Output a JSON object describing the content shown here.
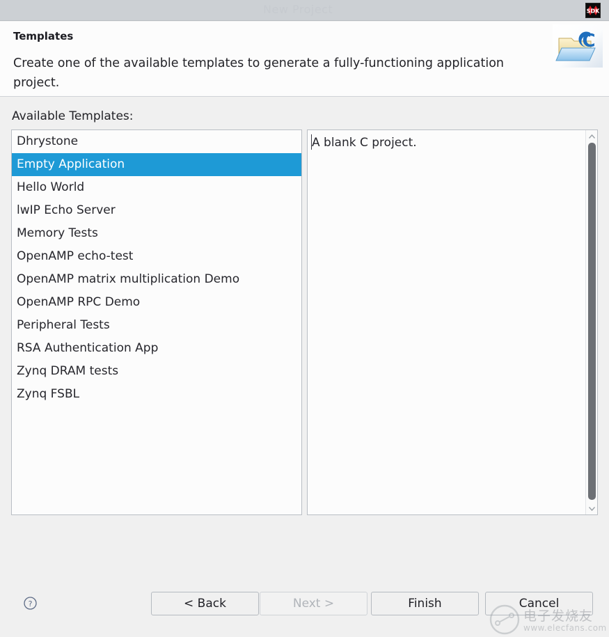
{
  "window": {
    "ghost_title": "New Project",
    "app_icon_label": "SDK"
  },
  "header": {
    "title": "Templates",
    "description": "Create one of the available templates to generate a fully-functioning application project.",
    "icon_name": "c-project-folder-icon"
  },
  "body": {
    "section_label": "Available Templates:",
    "templates": [
      {
        "label": "Dhrystone",
        "selected": false
      },
      {
        "label": "Empty Application",
        "selected": true
      },
      {
        "label": "Hello World",
        "selected": false
      },
      {
        "label": "lwIP Echo Server",
        "selected": false
      },
      {
        "label": "Memory Tests",
        "selected": false
      },
      {
        "label": "OpenAMP echo-test",
        "selected": false
      },
      {
        "label": "OpenAMP matrix multiplication Demo",
        "selected": false
      },
      {
        "label": "OpenAMP RPC Demo",
        "selected": false
      },
      {
        "label": "Peripheral Tests",
        "selected": false
      },
      {
        "label": "RSA Authentication App",
        "selected": false
      },
      {
        "label": "Zynq DRAM tests",
        "selected": false
      },
      {
        "label": "Zynq FSBL",
        "selected": false
      }
    ],
    "description_panel": {
      "text": "A blank C project."
    }
  },
  "footer": {
    "help_label": "?",
    "buttons": [
      {
        "label": "< Back",
        "enabled": true
      },
      {
        "label": "Next >",
        "enabled": false
      },
      {
        "label": "Finish",
        "enabled": true
      },
      {
        "label": "Cancel",
        "enabled": true
      }
    ]
  },
  "watermark": {
    "chinese": "电子发烧友",
    "url": "www.elecfans.com"
  },
  "colors": {
    "selection_blue": "#1e9ad6",
    "titlebar_gray": "#ccd0d4",
    "panel_bg": "#f0f0f0",
    "field_bg": "#fcfcfc",
    "border_gray": "#b9bec4",
    "scroll_thumb": "#6d7075"
  }
}
